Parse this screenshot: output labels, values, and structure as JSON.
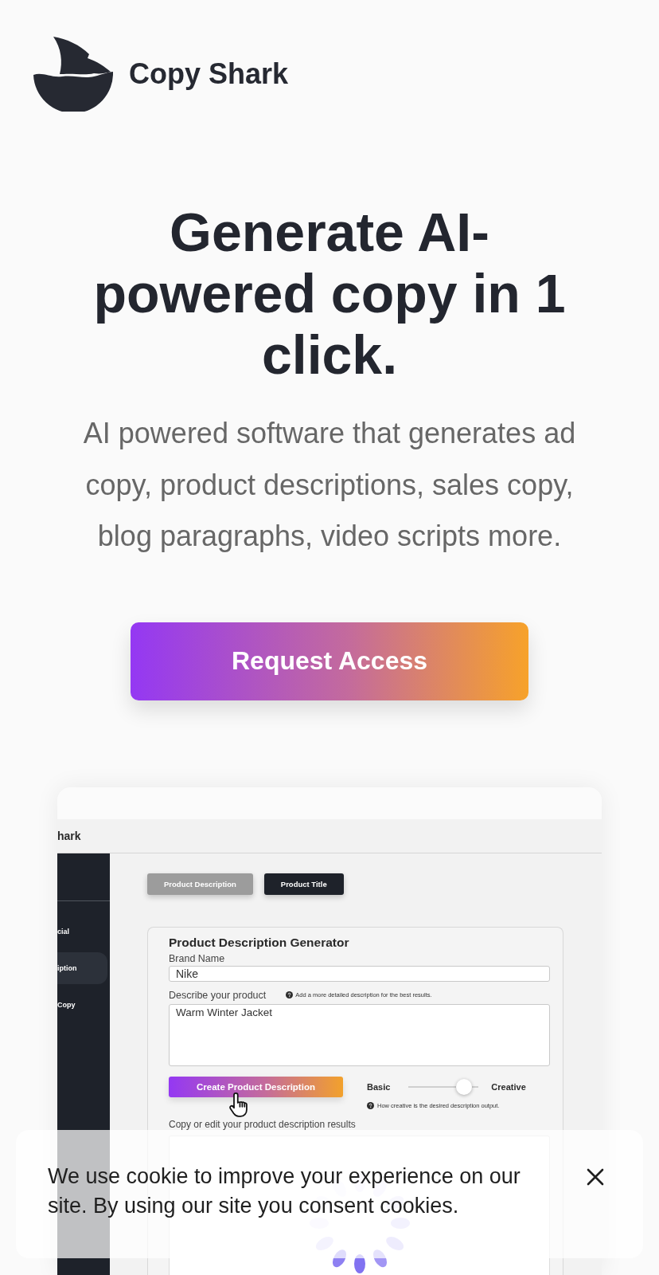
{
  "header": {
    "brand": "Copy Shark"
  },
  "hero": {
    "title": "Generate AI-powered copy in 1 click.",
    "subtitle": "AI powered software that generates ad copy, product descriptions, sales copy, blog paragraphs, video scripts more.",
    "cta": "Request Access"
  },
  "app_preview": {
    "brand": "hark",
    "sidebar": {
      "items": [
        {
          "label": "cial",
          "selected": false
        },
        {
          "label": "iption",
          "selected": true
        },
        {
          "label": "Copy",
          "selected": false
        }
      ]
    },
    "tabs": [
      {
        "label": "Product Description",
        "selected": true
      },
      {
        "label": "Product Title",
        "selected": false
      }
    ],
    "form": {
      "title": "Product Description Generator",
      "brand_name": {
        "label": "Brand Name",
        "value": "Nike"
      },
      "product": {
        "label": "Describe your product",
        "hint": "Add a more detailed description for the best results.",
        "value": "Warm Winter Jacket"
      },
      "generate_button": "Create Product Description",
      "creativity": {
        "min_label": "Basic",
        "max_label": "Creative",
        "level": 0.87,
        "hint": "How creative is the desired description output."
      },
      "results": {
        "label": "Copy or edit your product description results",
        "loading": true
      }
    }
  },
  "cookie_banner": {
    "text": "We use cookie to improve your experience on our site. By using our site you consent cookies."
  }
}
